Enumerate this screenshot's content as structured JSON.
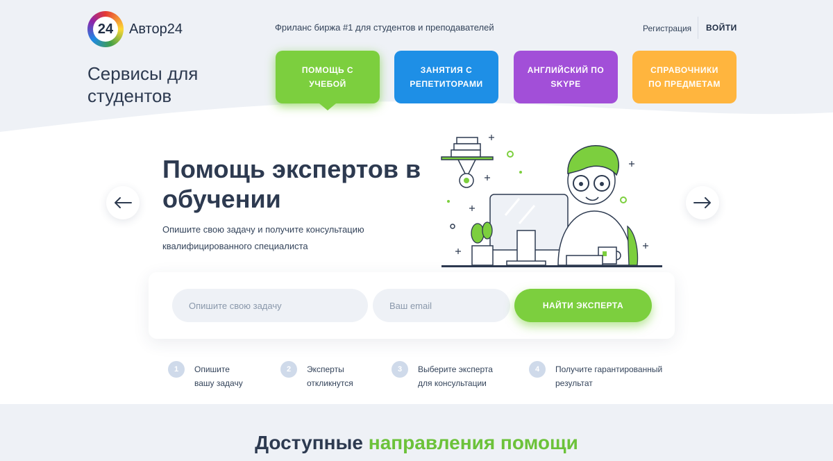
{
  "header": {
    "logo_number": "24",
    "logo_text": "Автор24",
    "tagline": "Фриланс биржа #1 для студентов и преподавателей",
    "register_label": "Регистрация",
    "login_label": "ВОЙТИ"
  },
  "services": {
    "title": "Сервисы для студентов",
    "tabs": [
      {
        "label": "ПОМОЩЬ С УЧЕБОЙ",
        "color": "#7ccf3e",
        "active": true
      },
      {
        "label": "ЗАНЯТИЯ С РЕПЕТИТОРАМИ",
        "color": "#1e8fe6"
      },
      {
        "label": "АНГЛИЙСКИЙ ПО SKYPE",
        "color": "#a24fd8"
      },
      {
        "label": "СПРАВОЧНИКИ ПО ПРЕДМЕТАМ",
        "color": "#ffb53e"
      }
    ]
  },
  "hero": {
    "title": "Помощь экспертов в обучении",
    "subtitle": "Опишите свою задачу и получите консультацию квалифицированного специалиста",
    "prev_icon": "arrow-left-icon",
    "next_icon": "arrow-right-icon"
  },
  "form": {
    "task_placeholder": "Опишите свою задачу",
    "email_placeholder": "Ваш email",
    "submit_label": "НАЙТИ ЭКСПЕРТА"
  },
  "steps": [
    {
      "num": "1",
      "line1": "Опишите",
      "line2": "вашу задачу"
    },
    {
      "num": "2",
      "line1": "Эксперты",
      "line2": "откликнутся"
    },
    {
      "num": "3",
      "line1": "Выберите эксперта",
      "line2": "для консультации"
    },
    {
      "num": "4",
      "line1": "Получите гарантированный",
      "line2": "результат"
    }
  ],
  "section": {
    "title_part1": "Доступные",
    "title_part2": "направления помощи"
  },
  "colors": {
    "accent_green": "#7ccf3e",
    "text_dark": "#2d3a50",
    "bg_light": "#eef1f6"
  }
}
